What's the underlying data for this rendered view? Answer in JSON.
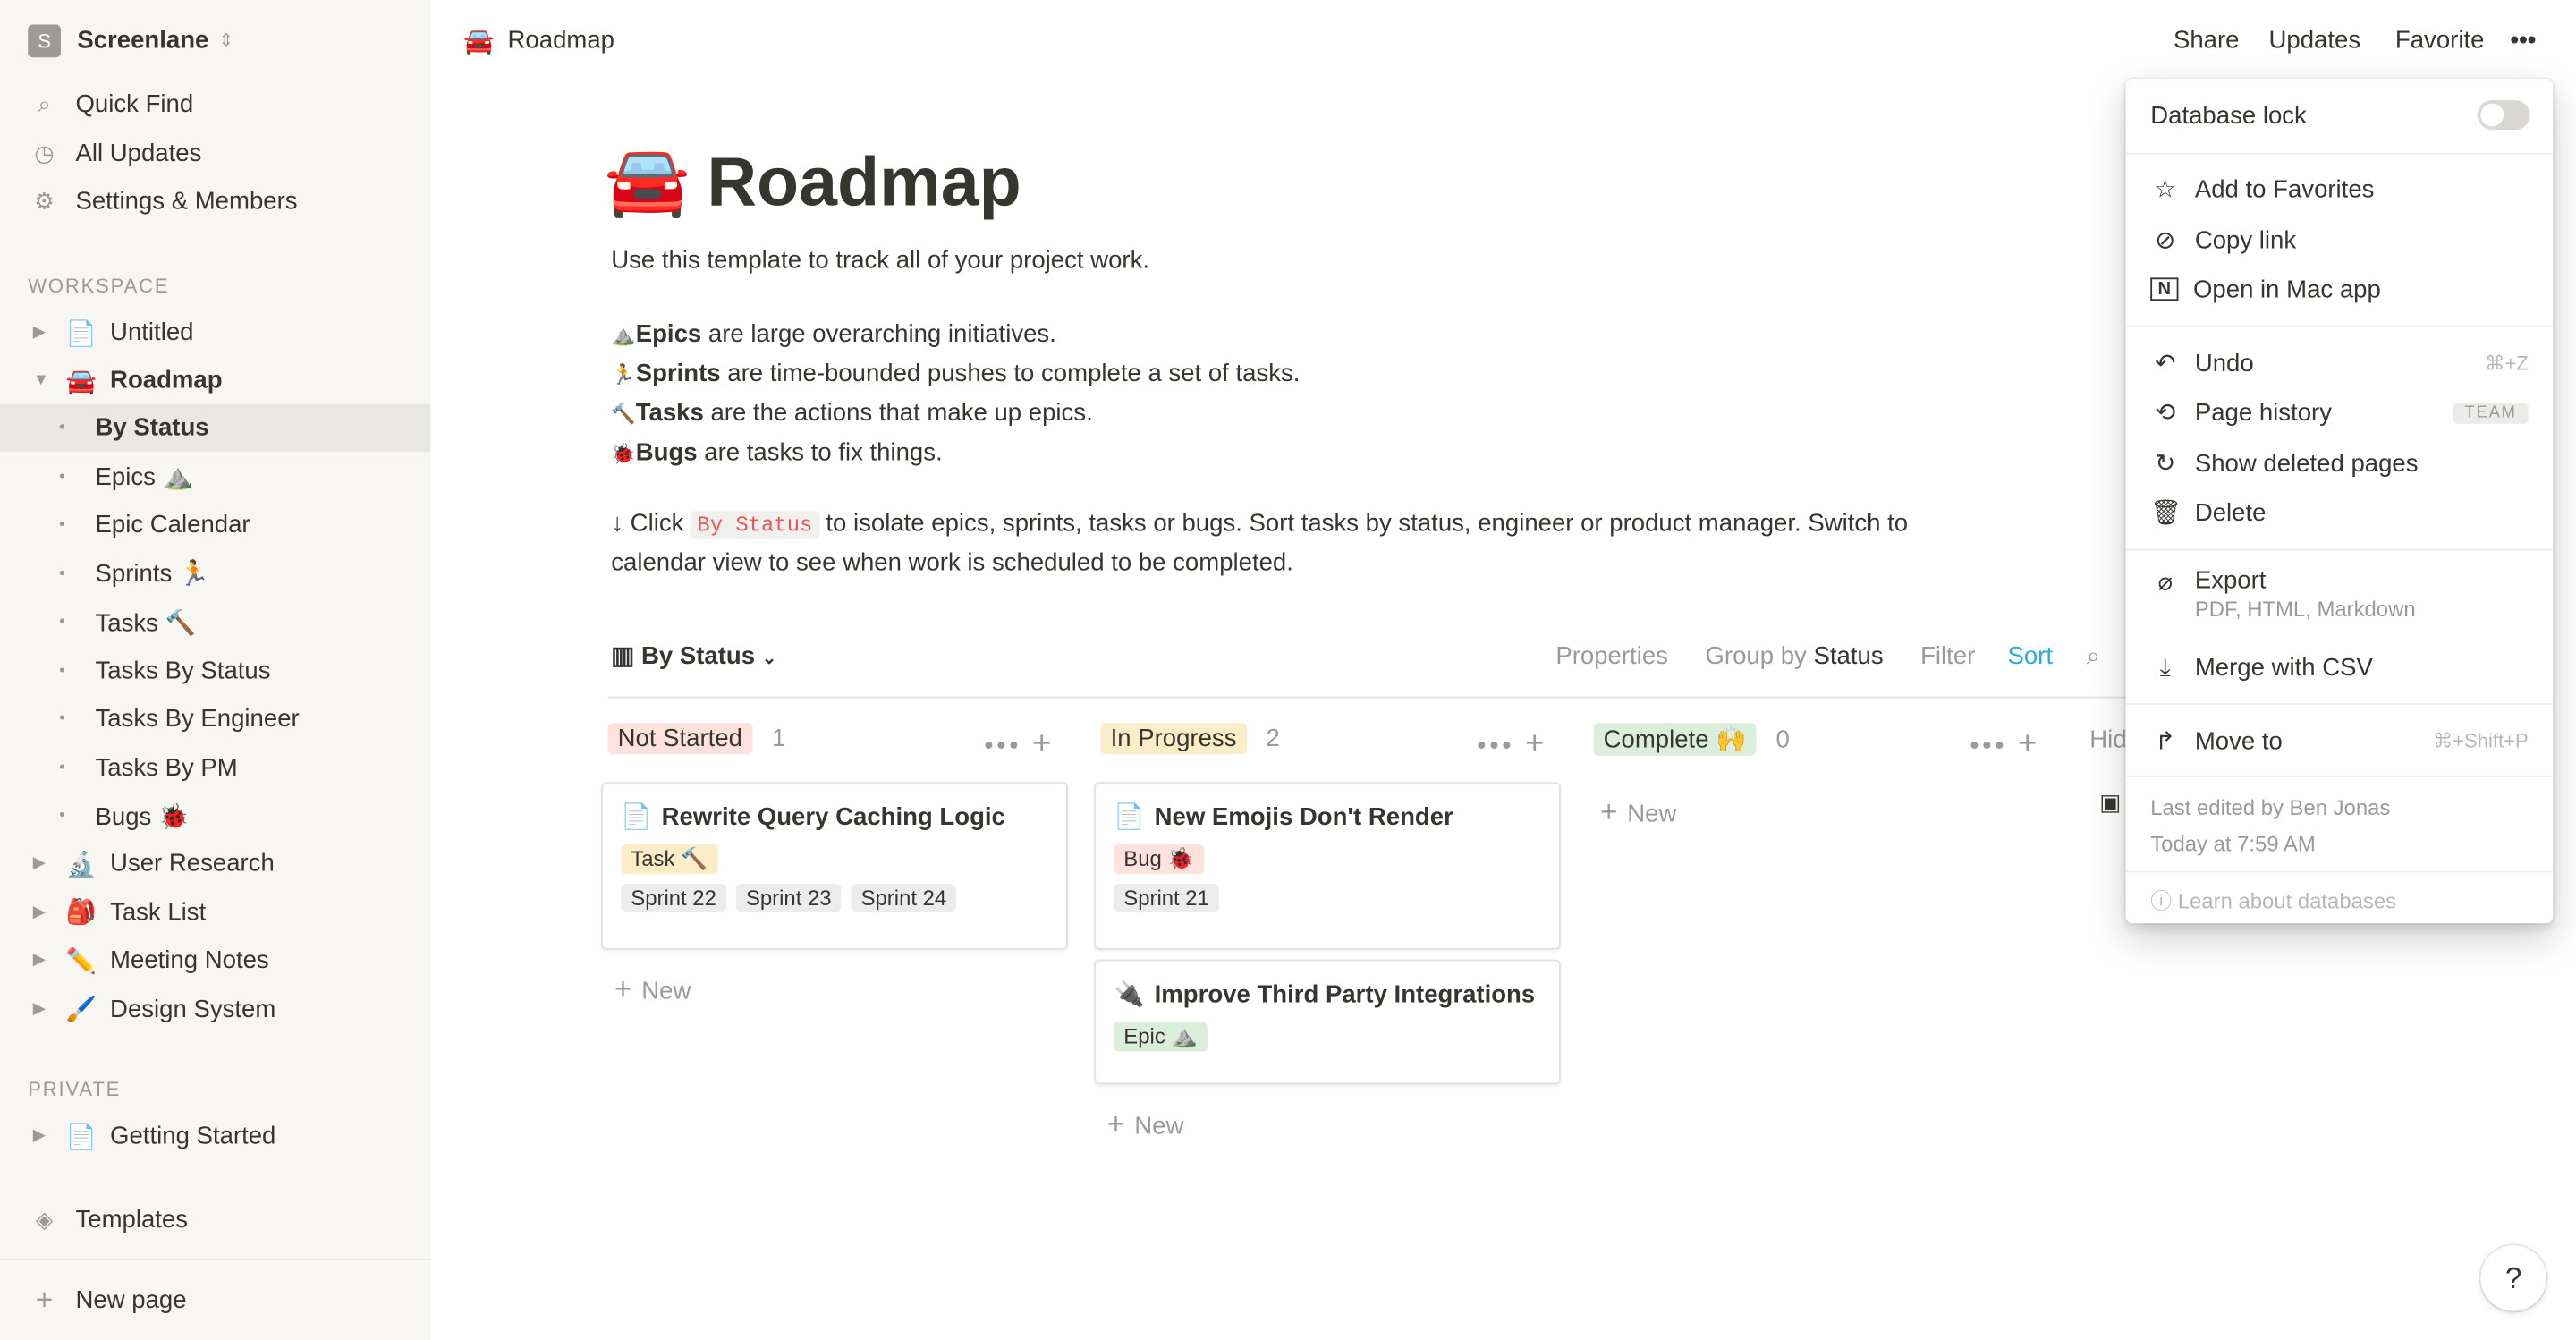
{
  "workspace": {
    "initial": "S",
    "name": "Screenlane"
  },
  "sidebar": {
    "top": [
      {
        "icon": "search-icon",
        "label": "Quick Find"
      },
      {
        "icon": "clock-icon",
        "label": "All Updates"
      },
      {
        "icon": "gear-icon",
        "label": "Settings & Members"
      }
    ],
    "workspace_label": "WORKSPACE",
    "pages": [
      {
        "emoji": "📄",
        "label": "Untitled"
      },
      {
        "emoji": "🚘",
        "label": "Roadmap"
      }
    ],
    "subpages": [
      "By Status",
      "Epics ⛰️",
      "Epic Calendar",
      "Sprints 🏃",
      "Tasks 🔨",
      "Tasks By Status",
      "Tasks By Engineer",
      "Tasks By PM",
      "Bugs 🐞"
    ],
    "pages2": [
      {
        "emoji": "🔬",
        "label": "User Research"
      },
      {
        "emoji": "🎒",
        "label": "Task List"
      },
      {
        "emoji": "✏️",
        "label": "Meeting Notes"
      },
      {
        "emoji": "🖌️",
        "label": "Design System"
      }
    ],
    "private_label": "PRIVATE",
    "private_pages": [
      {
        "emoji": "📄",
        "label": "Getting Started"
      }
    ],
    "templates": "Templates",
    "new_page": "New page"
  },
  "topbar": {
    "emoji": "🚘",
    "title": "Roadmap",
    "share": "Share",
    "updates": "Updates",
    "favorite": "Favorite",
    "more": "•••"
  },
  "page": {
    "emoji": "🚘",
    "title": "Roadmap",
    "intro": "Use this template to track all of your project work.",
    "bullets": [
      {
        "emoji": "⛰️",
        "bold": "Epics",
        "rest": " are large overarching initiatives."
      },
      {
        "emoji": "🏃",
        "bold": "Sprints",
        "rest": " are time-bounded pushes to complete a set of tasks."
      },
      {
        "emoji": "🔨",
        "bold": "Tasks",
        "rest": " are the actions that make up epics."
      },
      {
        "emoji": "🐞",
        "bold": "Bugs",
        "rest": " are tasks to fix things."
      }
    ],
    "click_pre": "↓ Click ",
    "click_code": "By Status",
    "click_post": " to isolate epics, sprints, tasks or bugs. Sort tasks by status, engineer or product manager. Switch to",
    "click_line2": "calendar view to see when work is scheduled to be completed."
  },
  "view": {
    "name": "By Status",
    "properties": "Properties",
    "group_by": "Group by",
    "group_value": "Status",
    "filter": "Filter",
    "sort": "Sort",
    "search_icon": "search-icon"
  },
  "board": {
    "new_label": "New",
    "hidden_label": "Hid",
    "columns": [
      {
        "name": "Not Started",
        "color": "#ffe2dd",
        "count": "1",
        "cards": [
          {
            "icon": "📄",
            "title": "Rewrite Query Caching Logic",
            "tags": [
              {
                "label": "Task 🔨",
                "color": "#fdecc8"
              }
            ],
            "sprints": [
              "Sprint 22",
              "Sprint 23",
              "Sprint 24"
            ]
          }
        ]
      },
      {
        "name": "In Progress",
        "color": "#fdecc8",
        "count": "2",
        "cards": [
          {
            "icon": "📄",
            "title": "New Emojis Don't Render",
            "tags": [
              {
                "label": "Bug 🐞",
                "color": "#ffe2dd"
              }
            ],
            "sprints": [
              "Sprint 21"
            ]
          },
          {
            "icon": "🔌",
            "title": "Improve Third Party Integrations",
            "tags": [
              {
                "label": "Epic ⛰️",
                "color": "#dbeddb"
              }
            ],
            "sprints": []
          }
        ]
      },
      {
        "name": "Complete 🙌",
        "color": "#dbeddb",
        "count": "0",
        "cards": []
      }
    ]
  },
  "menu": {
    "database_lock": "Database lock",
    "database_lock_on": false,
    "add_favorites": "Add to Favorites",
    "copy_link": "Copy link",
    "open_mac": "Open in Mac app",
    "undo": "Undo",
    "undo_shortcut": "⌘+Z",
    "page_history": "Page history",
    "team_badge": "TEAM",
    "show_deleted": "Show deleted pages",
    "delete": "Delete",
    "export": "Export",
    "export_sub": "PDF, HTML, Markdown",
    "merge_csv": "Merge with CSV",
    "move_to": "Move to",
    "move_shortcut": "⌘+Shift+P",
    "last_edited": "Last edited by Ben Jonas",
    "edited_time": "Today at 7:59 AM",
    "learn": "Learn about databases"
  },
  "help": "?"
}
